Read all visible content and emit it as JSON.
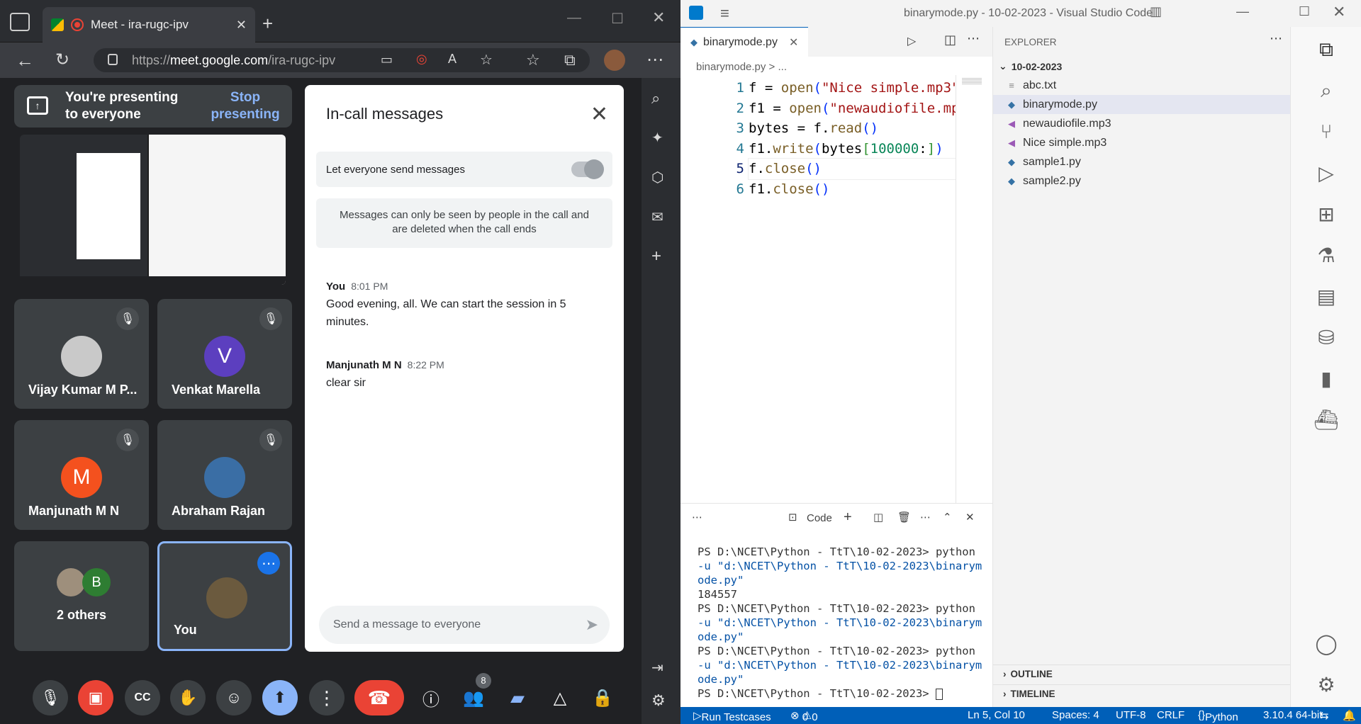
{
  "browser": {
    "tab_title": "Meet - ira-rugc-ipv",
    "url_prefix": "https://",
    "url_host": "meet.google.com",
    "url_path": "/ira-rugc-ipv"
  },
  "meet": {
    "presenting_text": "You're presenting to everyone",
    "stop_presenting": "Stop presenting",
    "participants": [
      {
        "name": "Vijay Kumar M P...",
        "avatar_letter": "",
        "avatar_color": "#c9c9c9"
      },
      {
        "name": "Venkat Marella",
        "avatar_letter": "V",
        "avatar_color": "#5c3fbf"
      },
      {
        "name": "Manjunath M N",
        "avatar_letter": "M",
        "avatar_color": "#f4511e"
      },
      {
        "name": "Abraham Rajan",
        "avatar_letter": "",
        "avatar_color": "#3a6ea5"
      },
      {
        "name": "2 others",
        "avatar_letter": "B",
        "avatar_color": "#2e7d32"
      },
      {
        "name": "You",
        "avatar_letter": "",
        "avatar_color": "#6b5a3e"
      }
    ],
    "people_count": "8"
  },
  "chat": {
    "title": "In-call messages",
    "toggle_label": "Let everyone send messages",
    "notice": "Messages can only be seen by people in the call and are deleted when the call ends",
    "messages": [
      {
        "sender": "You",
        "time": "8:01 PM",
        "text": "Good evening, all. We can start the session in 5 minutes."
      },
      {
        "sender": "Manjunath M N",
        "time": "8:22 PM",
        "text": "clear sir"
      }
    ],
    "input_placeholder": "Send a message to everyone"
  },
  "vscode": {
    "title": "binarymode.py - 10-02-2023 - Visual Studio Code",
    "tab_label": "binarymode.py",
    "breadcrumb": "binarymode.py > ...",
    "code_lines": [
      {
        "n": "1"
      },
      {
        "n": "2"
      },
      {
        "n": "3"
      },
      {
        "n": "4"
      },
      {
        "n": "5"
      },
      {
        "n": "6"
      }
    ],
    "panel_label": "Code",
    "terminal_lines": [
      "PS D:\\NCET\\Python - TtT\\10-02-2023> python",
      "-u \"d:\\NCET\\Python - TtT\\10-02-2023\\binarym",
      "ode.py\"",
      "184557",
      "PS D:\\NCET\\Python - TtT\\10-02-2023> python",
      "-u \"d:\\NCET\\Python - TtT\\10-02-2023\\binarym",
      "ode.py\"",
      "PS D:\\NCET\\Python - TtT\\10-02-2023> python",
      "-u \"d:\\NCET\\Python - TtT\\10-02-2023\\binarym",
      "ode.py\"",
      "PS D:\\NCET\\Python - TtT\\10-02-2023> "
    ],
    "explorer_title": "EXPLORER",
    "folder": "10-02-2023",
    "files": [
      "abc.txt",
      "binarymode.py",
      "newaudiofile.mp3",
      "Nice simple.mp3",
      "sample1.py",
      "sample2.py"
    ],
    "outline": "OUTLINE",
    "timeline": "TIMELINE",
    "status": {
      "run": "Run Testcases",
      "problems": "0",
      "warnings": "0",
      "position": "Ln 5, Col 10",
      "spaces": "Spaces: 4",
      "encoding": "UTF-8",
      "eol": "CRLF",
      "language": "Python",
      "interpreter": "3.10.4 64-bit"
    }
  },
  "colors": {
    "vscode_accent": "#005fb8",
    "meet_bg": "#202124",
    "end_call_red": "#ea4335",
    "present_blue": "#8ab4f8"
  }
}
